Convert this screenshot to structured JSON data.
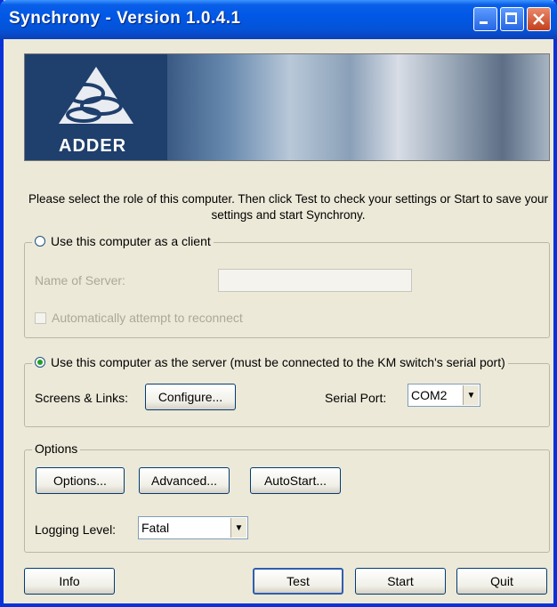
{
  "window": {
    "title": "Synchrony - Version 1.0.4.1"
  },
  "banner": {
    "logo_text": "ADDER"
  },
  "instructions": "Please select the role of this computer.  Then click Test to check your settings or Start to save your settings and start Synchrony.",
  "client_group": {
    "radio_label": "Use this computer as a client",
    "selected": false,
    "server_name_label": "Name of Server:",
    "server_name_value": "",
    "reconnect_label": "Automatically attempt to reconnect",
    "reconnect_checked": false
  },
  "server_group": {
    "radio_label": "Use this computer as the server (must be connected to the KM switch's serial port)",
    "selected": true,
    "screens_links_label": "Screens & Links:",
    "configure_button": "Configure...",
    "serial_port_label": "Serial Port:",
    "serial_port_value": "COM2"
  },
  "options_group": {
    "title": "Options",
    "options_button": "Options...",
    "advanced_button": "Advanced...",
    "autostart_button": "AutoStart...",
    "logging_label": "Logging Level:",
    "logging_value": "Fatal"
  },
  "buttons": {
    "info": "Info",
    "test": "Test",
    "start": "Start",
    "quit": "Quit"
  },
  "colors": {
    "titlebar": "#0058e6",
    "window_bg": "#ece9d8",
    "radio_selected": "#21a121"
  }
}
